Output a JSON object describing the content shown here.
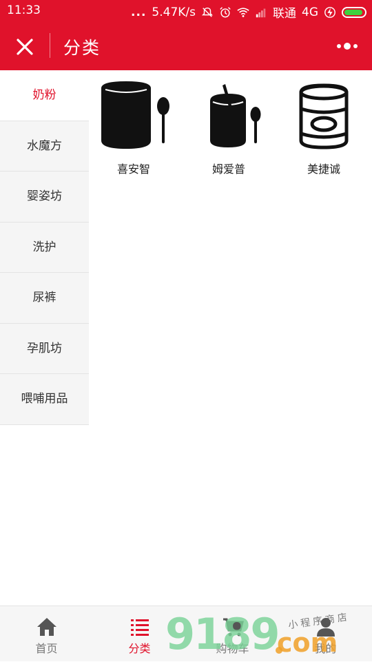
{
  "status_bar": {
    "time": "11:33",
    "dots": "...",
    "speed": "5.47K/s",
    "carrier": "联通",
    "network": "4G",
    "icons": [
      "mute-bell-icon",
      "alarm-icon",
      "wifi-icon",
      "signal-icon",
      "charging-icon",
      "battery-icon"
    ]
  },
  "nav": {
    "title": "分类",
    "close_icon": "close-icon",
    "more_icon": "more-icon"
  },
  "sidebar": {
    "items": [
      {
        "label": "奶粉",
        "active": true
      },
      {
        "label": "水魔方",
        "active": false
      },
      {
        "label": "婴姿坊",
        "active": false
      },
      {
        "label": "洗护",
        "active": false
      },
      {
        "label": "尿裤",
        "active": false
      },
      {
        "label": "孕肌坊",
        "active": false
      },
      {
        "label": "喂哺用品",
        "active": false
      }
    ]
  },
  "categories": [
    {
      "label": "喜安智",
      "icon": "formula-tin-spoon-icon"
    },
    {
      "label": "姆爱普",
      "icon": "formula-tin-scoop-icon"
    },
    {
      "label": "美捷诚",
      "icon": "canned-milk-icon"
    }
  ],
  "tabbar": {
    "tabs": [
      {
        "label": "首页",
        "icon": "home-icon",
        "active": false
      },
      {
        "label": "分类",
        "icon": "list-icon",
        "active": true
      },
      {
        "label": "购物车",
        "icon": "cart-icon",
        "active": false
      },
      {
        "label": "我的",
        "icon": "user-icon",
        "active": false
      }
    ]
  },
  "watermark": {
    "main": "9189",
    "domain": "com",
    "tagline": "小程序商店"
  },
  "colors": {
    "brand": "#e0122b",
    "sidebar_bg": "#f5f5f5",
    "tab_inactive": "#777777"
  }
}
